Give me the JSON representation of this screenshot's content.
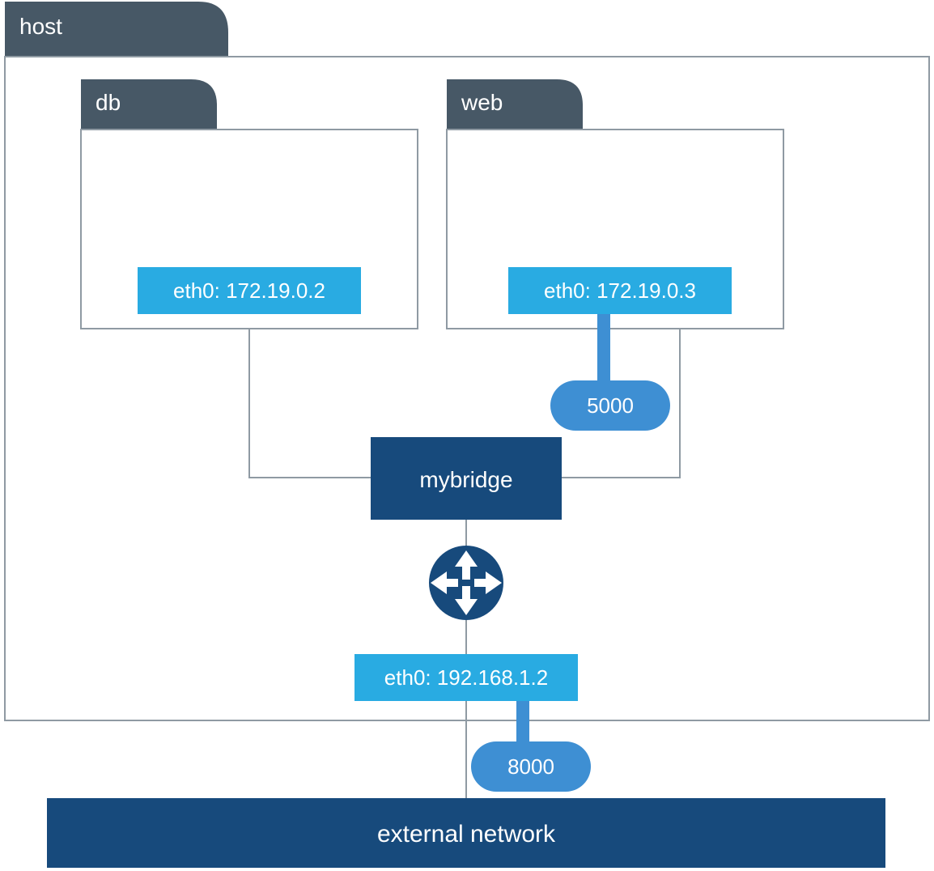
{
  "host": {
    "label": "host",
    "colors": {
      "tab_bg": "#475866",
      "border": "#8f9aa3",
      "canvas_bg": "#ffffff"
    }
  },
  "containers": {
    "db": {
      "label": "db",
      "nic": {
        "iface": "eth0",
        "ip": "172.19.0.2",
        "text": "eth0: 172.19.0.2"
      }
    },
    "web": {
      "label": "web",
      "nic": {
        "iface": "eth0",
        "ip": "172.19.0.3",
        "text": "eth0: 172.19.0.3"
      },
      "exposed_port": "5000"
    }
  },
  "bridge": {
    "label": "mybridge",
    "color": "#174a7c"
  },
  "host_nic": {
    "iface": "eth0",
    "ip": "192.168.1.2",
    "text": "eth0: 192.168.1.2",
    "published_port": "8000"
  },
  "external_network": {
    "label": "external network",
    "color": "#174a7c"
  },
  "palette": {
    "nic_bg": "#29abe2",
    "port_bg": "#3e8fd3",
    "router_bg": "#174a7c",
    "thick_link": "#3e8fd3",
    "thin_link": "#8f9aa3"
  }
}
